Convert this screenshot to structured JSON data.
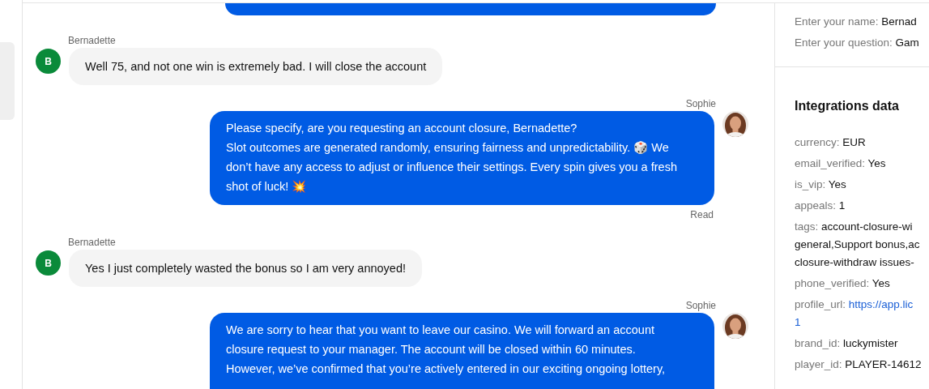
{
  "chat": {
    "partial_top_bubble": true,
    "messages": [
      {
        "kind": "customer",
        "sender": "Bernadette",
        "initial": "B",
        "lines": [
          "Well 75, and not one win is extremely bad. I will close the account"
        ]
      },
      {
        "kind": "agent",
        "sender": "Sophie",
        "lines": [
          "Please specify, are you requesting an account closure, Bernadette?",
          "Slot outcomes are generated randomly, ensuring fairness and unpredictability. 🎲 We",
          "don’t have any access to adjust or influence their settings. Every spin gives you a fresh",
          "shot of luck! 💥"
        ],
        "status": "Read"
      },
      {
        "kind": "customer",
        "sender": "Bernadette",
        "initial": "B",
        "lines": [
          "Yes I just completely wasted the bonus so I am very annoyed!"
        ]
      },
      {
        "kind": "agent",
        "sender": "Sophie",
        "lines": [
          "We are sorry to hear that you want to leave our casino. We will forward an account",
          "closure request to your manager. The account will be closed within 60 minutes.",
          "However, we’ve confirmed that you’re actively entered in our exciting ongoing lottery,"
        ]
      }
    ]
  },
  "details": {
    "prechat": [
      {
        "label": "Enter your name:",
        "lines": [
          "Bernad"
        ]
      },
      {
        "label": "Enter your question:",
        "lines": [
          "Gam"
        ]
      }
    ],
    "integrations_title": "Integrations data",
    "integrations": [
      {
        "label": "currency:",
        "lines": [
          "EUR"
        ]
      },
      {
        "label": "email_verified:",
        "lines": [
          "Yes"
        ]
      },
      {
        "label": "is_vip:",
        "lines": [
          "Yes"
        ]
      },
      {
        "label": "appeals:",
        "lines": [
          "1"
        ]
      },
      {
        "label": "tags:",
        "lines": [
          "account-closure-wi",
          "general,Support bonus,ac",
          "closure-withdraw issues-"
        ]
      },
      {
        "label": "phone_verified:",
        "lines": [
          "Yes"
        ]
      },
      {
        "label": "profile_url:",
        "kind": "link",
        "lines": [
          "https://app.lic",
          "1"
        ]
      },
      {
        "label": "brand_id:",
        "lines": [
          "luckymister"
        ]
      },
      {
        "label": "player_id:",
        "lines": [
          "PLAYER-14612"
        ]
      }
    ]
  }
}
